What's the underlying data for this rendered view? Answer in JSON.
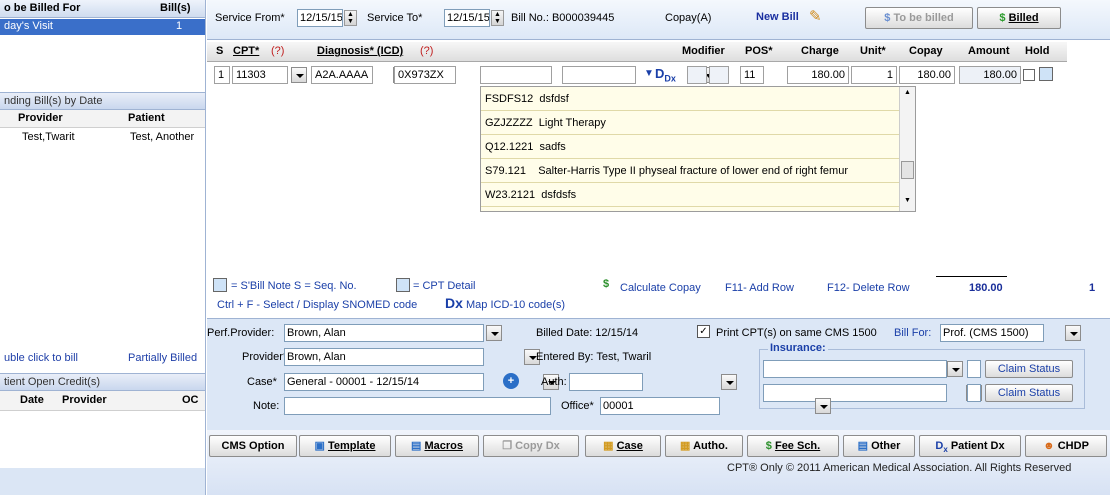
{
  "left_panel": {
    "header": {
      "title": "o be Billed For",
      "bills_label": "Bill(s)"
    },
    "selected_row": {
      "label": "day's Visit",
      "count": "1"
    },
    "pending_section": {
      "title": "nding Bill(s) by Date"
    },
    "pending_columns": {
      "provider": "Provider",
      "patient": "Patient"
    },
    "pending_rows": [
      {
        "provider": "Test,Twarit",
        "patient": "Test, Another"
      }
    ],
    "bottom": {
      "double_click": "uble click to bill",
      "partially": "Partially Billed"
    },
    "credit_section": {
      "title": "tient Open Credit(s)"
    },
    "credit_columns": {
      "date": "Date",
      "provider": "Provider",
      "oc": "OC"
    }
  },
  "topbar": {
    "service_from_label": "Service From*",
    "service_from_value": "12/15/15",
    "service_to_label": "Service To*",
    "service_to_value": "12/15/15",
    "bill_no": "Bill No.: B000039445",
    "copay_label": "Copay(A)",
    "new_bill": "New Bill",
    "to_be_billed": "To be billed",
    "billed": "Billed"
  },
  "grid": {
    "columns": {
      "s": "S",
      "cpt": "CPT*",
      "cpt_q": "(?)",
      "diagnosis": "Diagnosis* (ICD)",
      "diag_q": "(?)",
      "modifier": "Modifier",
      "pos": "POS*",
      "charge": "Charge",
      "unit": "Unit*",
      "copay": "Copay",
      "amount": "Amount",
      "hold": "Hold"
    },
    "row": {
      "seq": "1",
      "cpt": "11303",
      "diag1": "A2A.AAAA",
      "diag2": "0X973ZX",
      "dx_label": "Dx",
      "pos": "11",
      "charge": "180.00",
      "unit": "1",
      "copay": "180.00",
      "amount": "180.00"
    }
  },
  "dropdown": {
    "items": [
      {
        "code": "FSDFS12",
        "desc": "dsfdsf"
      },
      {
        "code": "GZJZZZZ",
        "desc": "Light Therapy"
      },
      {
        "code": "Q12.1221",
        "desc": "sadfs"
      },
      {
        "code": "S79.121",
        "desc": "Salter-Harris Type II physeal fracture of lower end of right femur"
      },
      {
        "code": "W23.2121",
        "desc": "dsfdsfs"
      }
    ]
  },
  "legend": {
    "line1": "= S'Bill  Note S = Seq. No.",
    "cpt_detail": "= CPT Detail",
    "line2": "Ctrl + F - Select / Display SNOMED code",
    "map_dx": "Dx",
    "map_text": "Map ICD-10 code(s)",
    "calc_copay": "Calculate Copay",
    "f11": "F11- Add Row",
    "f12": "F12- Delete Row",
    "total": "180.00",
    "count": "1"
  },
  "lower": {
    "perf_provider_label": "Perf.Provider:",
    "perf_provider_value": "Brown, Alan",
    "billed_date": "Billed Date: 12/15/14",
    "print_cpt": "Print CPT(s) on same CMS 1500",
    "bill_for_label": "Bill For:",
    "bill_for_value": "Prof. (CMS 1500)",
    "provider_label": "Provider*",
    "provider_value": "Brown, Alan",
    "entered_by": "Entered By: Test, Twaril",
    "insurance_label": "Insurance:",
    "claim_status": "Claim Status",
    "case_label": "Case*",
    "case_value": "General  -  00001 - 12/15/14",
    "auth_label": "Auth:",
    "note_label": "Note:",
    "office_label": "Office*",
    "office_value": "00001"
  },
  "toolbar": {
    "cms_option": "CMS Option",
    "template": "Template",
    "macros": "Macros",
    "copy_dx": "Copy Dx",
    "case": "Case",
    "autho": "Autho.",
    "fee_sch": "Fee Sch.",
    "other": "Other",
    "patient_dx": "Patient Dx",
    "chdp": "CHDP"
  },
  "copyright": "CPT® Only © 2011 American Medical Association.  All Rights Reserved"
}
